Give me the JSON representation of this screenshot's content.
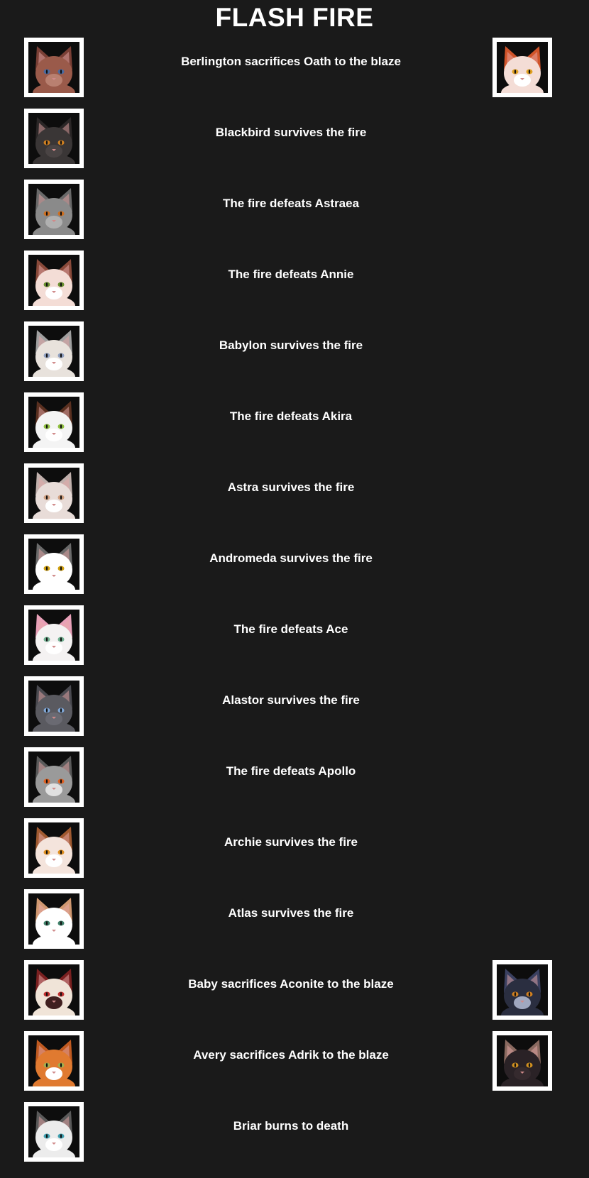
{
  "title": "FLASH FIRE",
  "events": [
    {
      "text": "Berlington sacrifices Oath to the blaze",
      "left": {
        "name": "berlington",
        "fur": "#9a5a4a",
        "ear": "#7a3f35",
        "eye": "#4a6aa0",
        "muzzle": "#b98070"
      },
      "right": {
        "name": "oath",
        "fur": "#f4ddd6",
        "ear": "#d0542a",
        "eye": "#e0a020",
        "muzzle": "#ffffff"
      }
    },
    {
      "text": "Blackbird survives the fire",
      "left": {
        "name": "blackbird",
        "fur": "#3a3636",
        "ear": "#2a2626",
        "eye": "#d08020",
        "muzzle": "#4a4444"
      },
      "right": null
    },
    {
      "text": "The fire defeats Astraea",
      "left": {
        "name": "astraea",
        "fur": "#8a8a8a",
        "ear": "#6a6a6a",
        "eye": "#d07020",
        "muzzle": "#b0b0b0"
      },
      "right": null
    },
    {
      "text": "The fire defeats Annie",
      "left": {
        "name": "annie",
        "fur": "#f4ddd6",
        "ear": "#8a4a3a",
        "eye": "#6a9030",
        "muzzle": "#ffffff"
      },
      "right": null
    },
    {
      "text": "Babylon survives the fire",
      "left": {
        "name": "babylon",
        "fur": "#e8e2dc",
        "ear": "#a0a0a0",
        "eye": "#90a0c0",
        "muzzle": "#ffffff"
      },
      "right": null
    },
    {
      "text": "The fire defeats Akira",
      "left": {
        "name": "akira",
        "fur": "#f4f4f4",
        "ear": "#5a3020",
        "eye": "#90c040",
        "muzzle": "#ffffff"
      },
      "right": null
    },
    {
      "text": "Astra survives the fire",
      "left": {
        "name": "astra",
        "fur": "#e8dcd8",
        "ear": "#c0b0ac",
        "eye": "#d0a080",
        "muzzle": "#ffffff"
      },
      "right": null
    },
    {
      "text": "Andromeda survives the fire",
      "left": {
        "name": "andromeda",
        "fur": "#ffffff",
        "ear": "#6a6a6a",
        "eye": "#d0a010",
        "muzzle": "#ffffff"
      },
      "right": null
    },
    {
      "text": "The fire defeats Ace",
      "left": {
        "name": "ace",
        "fur": "#f4f2f2",
        "ear": "#e8a0b8",
        "eye": "#70b090",
        "muzzle": "#ffffff"
      },
      "right": null
    },
    {
      "text": "Alastor survives the fire",
      "left": {
        "name": "alastor",
        "fur": "#5a5a60",
        "ear": "#4a4a50",
        "eye": "#80a8d8",
        "muzzle": "#6a6a72"
      },
      "right": null
    },
    {
      "text": "The fire defeats Apollo",
      "left": {
        "name": "apollo",
        "fur": "#9a9a9a",
        "ear": "#5a5a5a",
        "eye": "#e06020",
        "muzzle": "#e0e0e0"
      },
      "right": null
    },
    {
      "text": "Archie survives the fire",
      "left": {
        "name": "archie",
        "fur": "#f4e4dc",
        "ear": "#a05a30",
        "eye": "#e09020",
        "muzzle": "#ffffff"
      },
      "right": null
    },
    {
      "text": "Atlas survives the fire",
      "left": {
        "name": "atlas",
        "fur": "#ffffff",
        "ear": "#d09870",
        "eye": "#40806a",
        "muzzle": "#ffffff"
      },
      "right": null
    },
    {
      "text": "Baby sacrifices Aconite to the blaze",
      "left": {
        "name": "baby",
        "fur": "#f0e4d8",
        "ear": "#7a2020",
        "eye": "#c03030",
        "muzzle": "#402020"
      },
      "right": {
        "name": "aconite",
        "fur": "#2a2e40",
        "ear": "#3a4060",
        "eye": "#d08020",
        "muzzle": "#a0a8c0"
      }
    },
    {
      "text": "Avery sacrifices Adrik to the blaze",
      "left": {
        "name": "avery",
        "fur": "#e07a30",
        "ear": "#c05a20",
        "eye": "#a0b050",
        "muzzle": "#ffffff"
      },
      "right": {
        "name": "adrik",
        "fur": "#2a2226",
        "ear": "#8a6a60",
        "eye": "#d09020",
        "muzzle": "#352a2e"
      }
    },
    {
      "text": "Briar burns to death",
      "left": {
        "name": "briar",
        "fur": "#ececec",
        "ear": "#5a5a5a",
        "eye": "#40a0b0",
        "muzzle": "#ffffff"
      },
      "right": null
    }
  ]
}
